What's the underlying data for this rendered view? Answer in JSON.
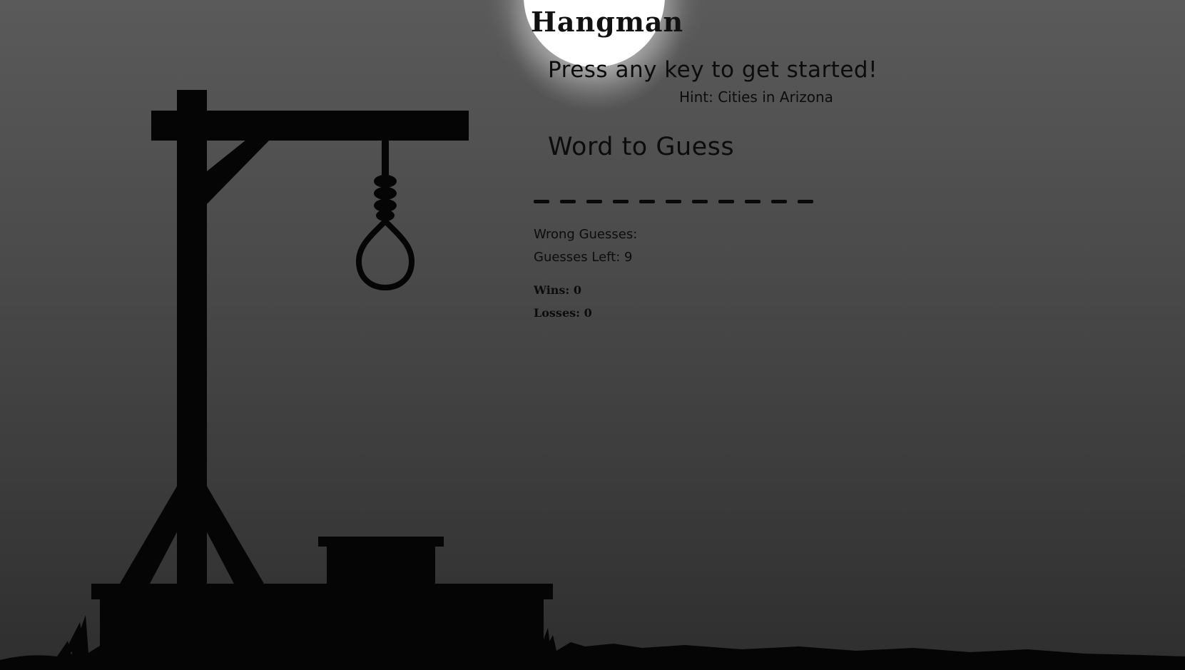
{
  "header": {
    "title": "Hangman"
  },
  "game": {
    "prompt": "Press any key to get started!",
    "hint": "Hint: Cities in Arizona",
    "word_heading": "Word to Guess",
    "blank_count": 11,
    "wrong_guesses_label": "Wrong Guesses:",
    "wrong_guesses_value": "",
    "guesses_left_label": "Guesses Left:",
    "guesses_left_value": "9",
    "wins_label": "Wins:",
    "wins_value": "0",
    "losses_label": "Losses:",
    "losses_value": "0"
  },
  "colors": {
    "background_top": "#5a5a5a",
    "background_bottom": "#2e2e2e",
    "silhouette": "#050505",
    "moon": "#ffffff"
  },
  "icons": {
    "gallows": "gallows-icon",
    "noose": "noose-icon",
    "moon": "moon-icon"
  }
}
